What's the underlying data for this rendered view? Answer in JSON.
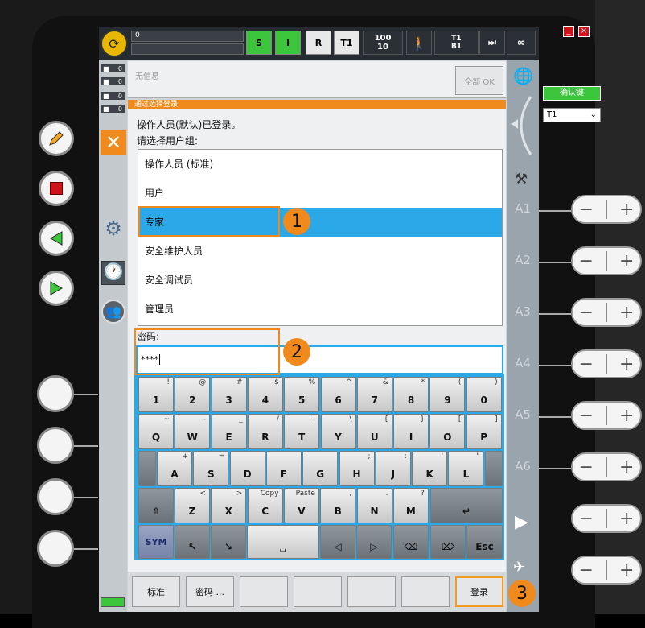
{
  "topbar": {
    "status_line": "0",
    "s": "S",
    "i": "I",
    "r": "R",
    "mode": "T1",
    "speed_prog": "100",
    "speed_manual": "10",
    "tool_label": "T1",
    "base_label": "B1",
    "inf": "∞"
  },
  "indicators": [
    "0",
    "0",
    "0",
    "0"
  ],
  "message": {
    "text": "无信息",
    "ack_all": "全部 OK"
  },
  "right_panel": {
    "confirm": "确认键",
    "mode_select": "T1",
    "axes": [
      "A1",
      "A2",
      "A3",
      "A4",
      "A5",
      "A6"
    ]
  },
  "login": {
    "header": "通过选择登录",
    "current_user": "操作人员(默认)已登录。",
    "prompt": "请选择用户组:",
    "groups": [
      "操作人员 (标准)",
      "用户",
      "专家",
      "安全维护人员",
      "安全调试员",
      "管理员"
    ],
    "selected_index": 2,
    "password_label": "密码:",
    "password_value": "****"
  },
  "keyboard": {
    "row1": [
      [
        "1",
        "!"
      ],
      [
        "2",
        "@"
      ],
      [
        "3",
        "#"
      ],
      [
        "4",
        "$"
      ],
      [
        "5",
        "%"
      ],
      [
        "6",
        "^"
      ],
      [
        "7",
        "&"
      ],
      [
        "8",
        "*"
      ],
      [
        "9",
        "("
      ],
      [
        "0",
        ")"
      ]
    ],
    "row2": [
      [
        "Q",
        "~"
      ],
      [
        "W",
        "-"
      ],
      [
        "E",
        "_"
      ],
      [
        "R",
        "/"
      ],
      [
        "T",
        "|"
      ],
      [
        "Y",
        "\\"
      ],
      [
        "U",
        "{"
      ],
      [
        "I",
        "}"
      ],
      [
        "O",
        "["
      ],
      [
        "P",
        "]"
      ]
    ],
    "row3": [
      [
        "A",
        "+"
      ],
      [
        "S",
        "="
      ],
      [
        "D",
        ""
      ],
      [
        "F",
        ""
      ],
      [
        "G",
        ""
      ],
      [
        "H",
        ";"
      ],
      [
        "J",
        ":"
      ],
      [
        "K",
        "'"
      ],
      [
        "L",
        "\""
      ]
    ],
    "row4": [
      [
        "Z",
        "<"
      ],
      [
        "X",
        ">"
      ],
      [
        "C",
        "Copy"
      ],
      [
        "V",
        "Paste"
      ],
      [
        "B",
        ","
      ],
      [
        "N",
        "."
      ],
      [
        "M",
        "?"
      ]
    ],
    "shift": "⇧",
    "enter": "↵",
    "sym": "SYM",
    "up_left": "↖",
    "down_right": "↘",
    "space": "␣",
    "left": "◁",
    "right": "▷",
    "backspace": "⌫",
    "delete": "⌦",
    "esc": "Esc"
  },
  "bottom": {
    "standard": "标准",
    "password": "密码 ...",
    "login": "登录"
  },
  "callouts": [
    "1",
    "2",
    "3"
  ],
  "jog": {
    "minus": "−",
    "plus": "+"
  }
}
